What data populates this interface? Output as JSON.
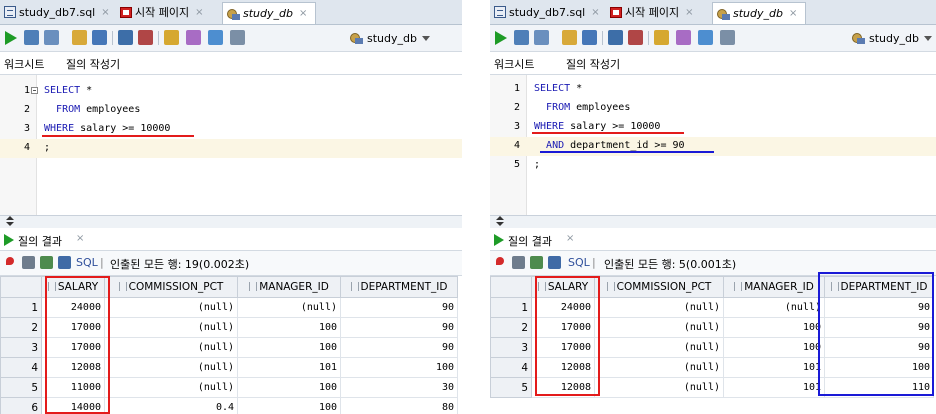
{
  "tabs": {
    "file": "study_db7.sql",
    "start": "시작 페이지",
    "connection": "study_db",
    "close": "×"
  },
  "toolbar": {
    "connection_label": "study_db"
  },
  "subtabs": {
    "worksheet": "워크시트",
    "query_builder": "질의 작성기"
  },
  "results": {
    "tab_title": "질의 결과",
    "close": "×",
    "sql_label": "SQL",
    "separator": "|",
    "columns": [
      "SALARY",
      "COMMISSION_PCT",
      "MANAGER_ID",
      "DEPARTMENT_ID"
    ]
  },
  "left": {
    "lines": [
      {
        "num": "1",
        "kw": "SELECT",
        "rest": " *"
      },
      {
        "num": "2",
        "pre": "  ",
        "kw": "FROM",
        "rest": " employees"
      },
      {
        "num": "3",
        "kw": "WHERE",
        "rest": " salary >= 10000"
      },
      {
        "num": "4",
        "rest": ";"
      }
    ],
    "fetch_text": "인출된 모든 행: 19(0.002초)",
    "rows": [
      {
        "n": "1",
        "salary": "24000",
        "comm": "(null)",
        "mgr": "(null)",
        "dept": "90"
      },
      {
        "n": "2",
        "salary": "17000",
        "comm": "(null)",
        "mgr": "100",
        "dept": "90"
      },
      {
        "n": "3",
        "salary": "17000",
        "comm": "(null)",
        "mgr": "100",
        "dept": "90"
      },
      {
        "n": "4",
        "salary": "12008",
        "comm": "(null)",
        "mgr": "101",
        "dept": "100"
      },
      {
        "n": "5",
        "salary": "11000",
        "comm": "(null)",
        "mgr": "100",
        "dept": "30"
      },
      {
        "n": "6",
        "salary": "14000",
        "comm": "0.4",
        "mgr": "100",
        "dept": "80"
      }
    ]
  },
  "right": {
    "lines": [
      {
        "num": "1",
        "kw": "SELECT",
        "rest": " *"
      },
      {
        "num": "2",
        "pre": "  ",
        "kw": "FROM",
        "rest": " employees"
      },
      {
        "num": "3",
        "kw": "WHERE",
        "rest": " salary >= 10000"
      },
      {
        "num": "4",
        "pre": "  ",
        "kw": "AND",
        "rest": " department_id >= 90"
      },
      {
        "num": "5",
        "rest": ";"
      }
    ],
    "fetch_text": "인출된 모든 행: 5(0.001초)",
    "rows": [
      {
        "n": "1",
        "salary": "24000",
        "comm": "(null)",
        "mgr": "(null)",
        "dept": "90"
      },
      {
        "n": "2",
        "salary": "17000",
        "comm": "(null)",
        "mgr": "100",
        "dept": "90"
      },
      {
        "n": "3",
        "salary": "17000",
        "comm": "(null)",
        "mgr": "100",
        "dept": "90"
      },
      {
        "n": "4",
        "salary": "12008",
        "comm": "(null)",
        "mgr": "101",
        "dept": "100"
      },
      {
        "n": "5",
        "salary": "12008",
        "comm": "(null)",
        "mgr": "101",
        "dept": "110"
      }
    ]
  },
  "colors": {
    "highlight_red": "#e31b1b",
    "highlight_blue": "#1a1ad6",
    "keyword": "#1a1ab3"
  }
}
